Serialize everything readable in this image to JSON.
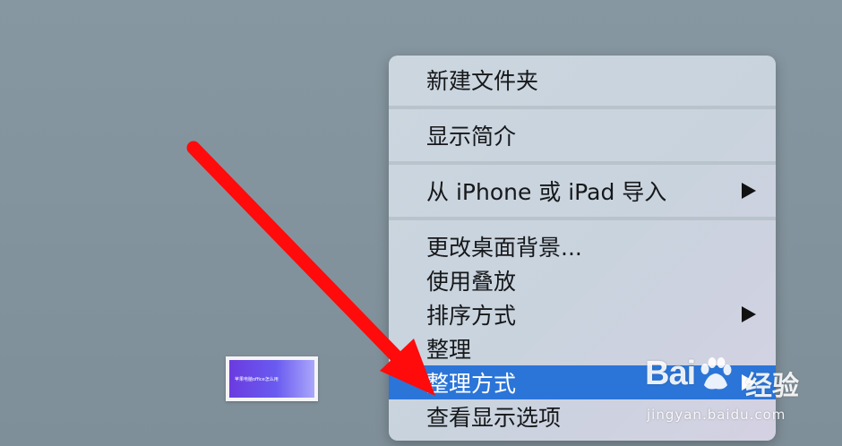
{
  "context_menu": {
    "items": [
      {
        "label": "新建文件夹",
        "has_submenu": false
      },
      {
        "label": "显示简介",
        "has_submenu": false
      },
      {
        "label": "从 iPhone 或 iPad 导入",
        "has_submenu": true
      },
      {
        "label": "更改桌面背景...",
        "has_submenu": false
      },
      {
        "label": "使用叠放",
        "has_submenu": false
      },
      {
        "label": "排序方式",
        "has_submenu": true
      },
      {
        "label": "整理",
        "has_submenu": false
      },
      {
        "label": "整理方式",
        "has_submenu": true,
        "highlighted": true
      },
      {
        "label": "查看显示选项",
        "has_submenu": false
      }
    ],
    "highlight_color": "#2b75d8"
  },
  "desktop_thumbnail": {
    "caption": "苹果电脑office怎么用"
  },
  "annotation": {
    "color": "#ff0b0b",
    "icon": "red-arrow"
  },
  "watermark": {
    "logo_text": "Bai",
    "logo_icon": "paw-icon",
    "brand_cn": "经验",
    "url": "jingyan.baidu.com"
  }
}
